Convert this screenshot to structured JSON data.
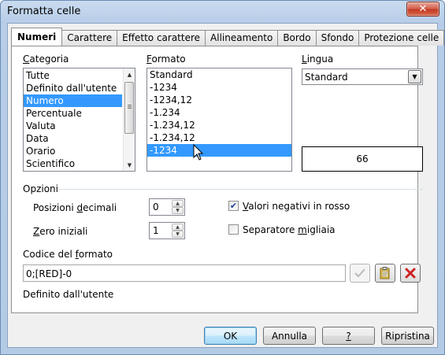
{
  "window": {
    "title": "Formatta celle",
    "close_glyph": "✕"
  },
  "tabs": [
    {
      "label": "Numeri",
      "active": true
    },
    {
      "label": "Carattere",
      "active": false
    },
    {
      "label": "Effetto carattere",
      "active": false
    },
    {
      "label": "Allineamento",
      "active": false
    },
    {
      "label": "Bordo",
      "active": false
    },
    {
      "label": "Sfondo",
      "active": false
    },
    {
      "label": "Protezione celle",
      "active": false
    }
  ],
  "category": {
    "label_u": "C",
    "label_rest": "ategoria",
    "items": [
      "Tutte",
      "Definito dall'utente",
      "Numero",
      "Percentuale",
      "Valuta",
      "Data",
      "Orario",
      "Scientifico"
    ],
    "selected_index": 2
  },
  "format": {
    "label_u": "F",
    "label_rest": "ormato",
    "items": [
      "Standard",
      "-1234",
      "-1234,12",
      "-1.234",
      "-1.234,12",
      "-1.234,12",
      "-1234"
    ],
    "selected_index": 6
  },
  "language": {
    "label_u": "L",
    "label_rest": "ingua",
    "value": "Standard"
  },
  "preview": {
    "value": "66"
  },
  "options": {
    "heading": "Opzioni",
    "decimals": {
      "label_pre": "Posizioni ",
      "label_u": "d",
      "label_post": "ecimali",
      "value": "0"
    },
    "leading_zeros": {
      "label_u": "Z",
      "label_post": "ero iniziali",
      "value": "1"
    },
    "negative_red": {
      "label_u": "V",
      "label_post": "alori negativi in rosso",
      "checked": true
    },
    "thousands_sep": {
      "label_pre": "Separatore ",
      "label_u": "m",
      "label_post": "igliaia",
      "checked": false
    }
  },
  "format_code": {
    "label_pre": "Codice del ",
    "label_u": "f",
    "label_post": "ormato",
    "value": "0;[RED]-0",
    "description": "Definito dall'utente"
  },
  "buttons": {
    "ok": "OK",
    "cancel": "Annulla",
    "help_u": "?",
    "reset": "Ripristina"
  },
  "colors": {
    "selection": "#3399ff",
    "delete_icon": "#cc2222",
    "check_icon": "#21449a"
  }
}
